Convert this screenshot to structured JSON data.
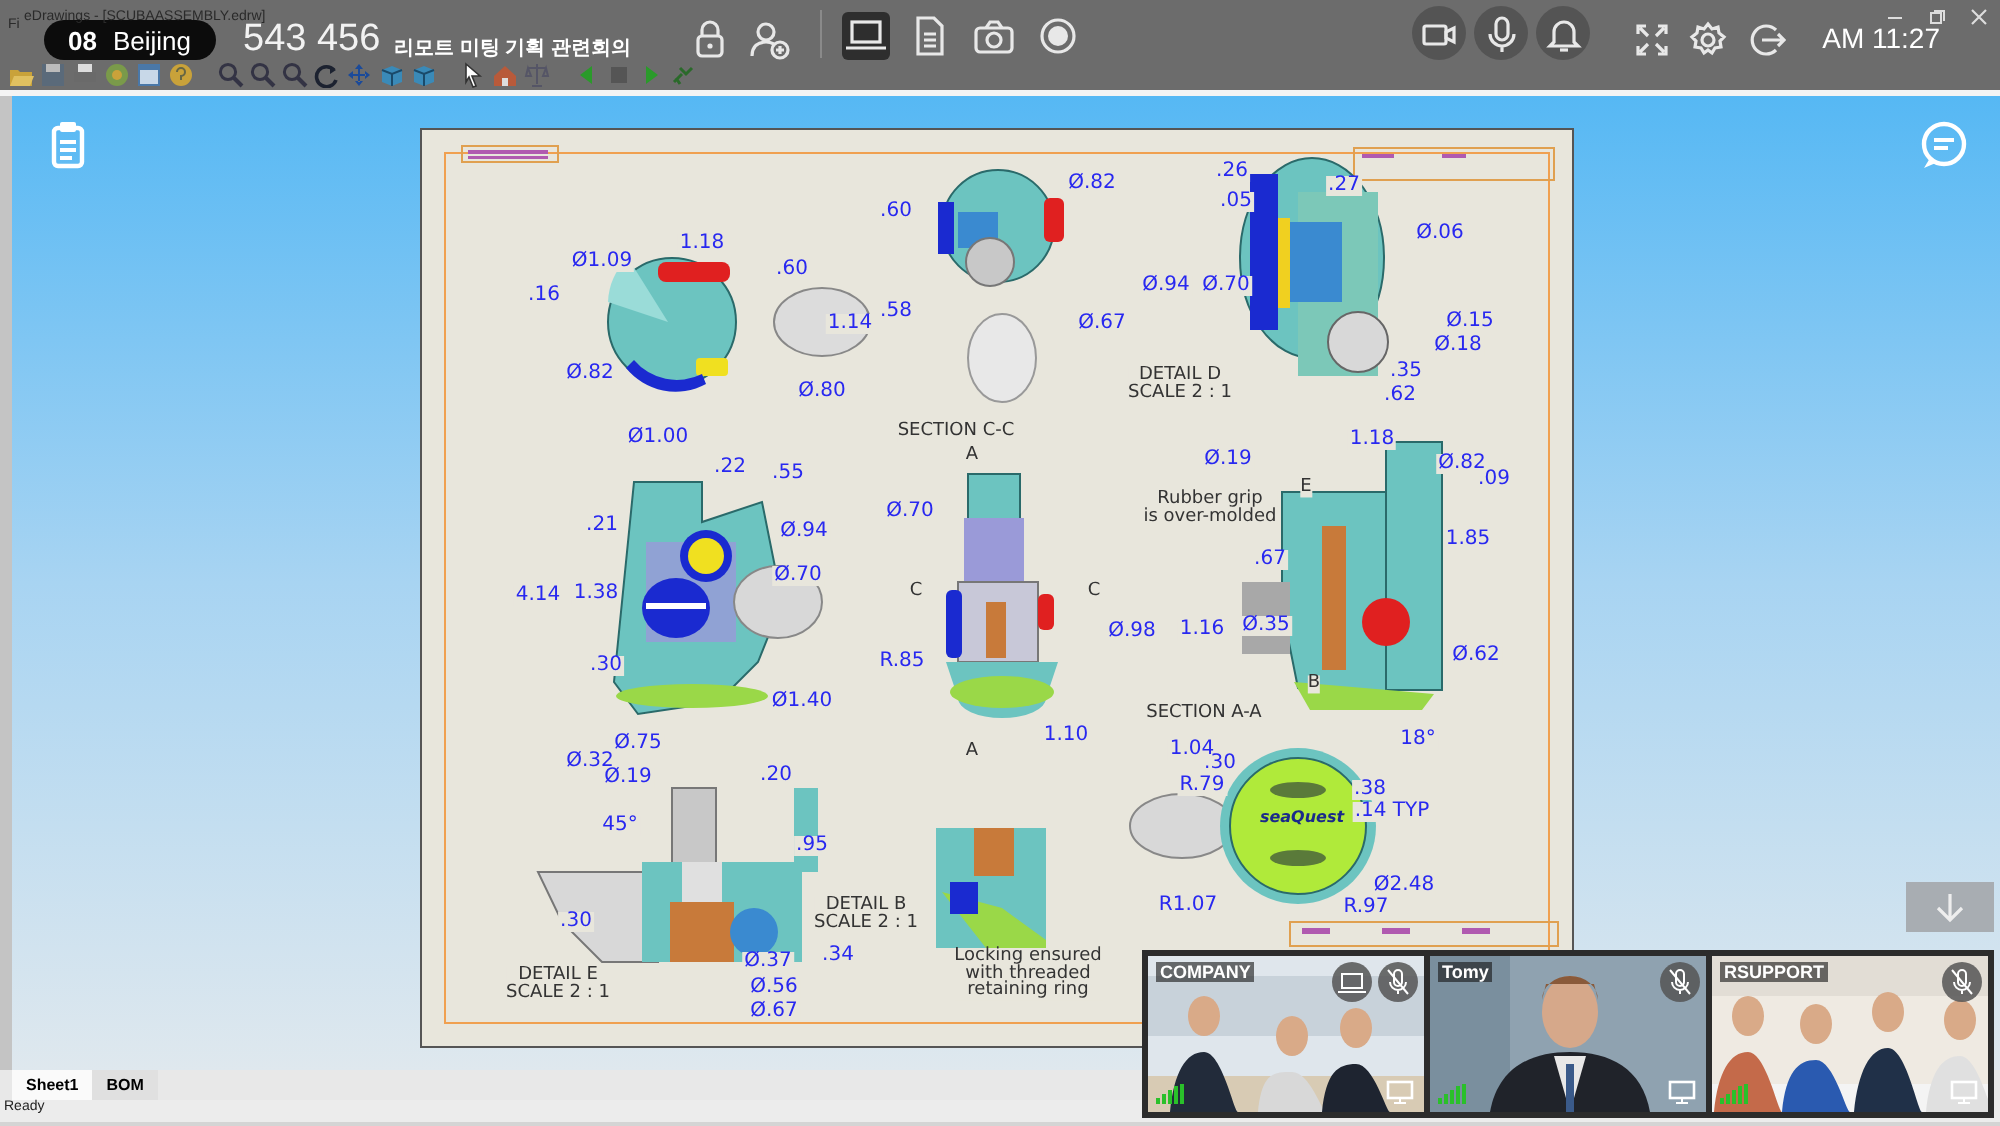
{
  "app_window": {
    "title": "eDrawings - [SCUBAASSEMBLY.edrw]",
    "menu_fragment": "Fi"
  },
  "meeting": {
    "room_number": "08",
    "room_name": "Beijing",
    "meeting_id": "543 456",
    "meeting_title": "리모트 미팅 기획 관련회의",
    "clock": "AM 11:27"
  },
  "share_modes": [
    {
      "kind": "screen",
      "selected": true
    },
    {
      "kind": "document",
      "selected": false
    },
    {
      "kind": "camera",
      "selected": false
    },
    {
      "kind": "record",
      "selected": false
    }
  ],
  "drawing": {
    "labels": [
      {
        "kind": "dimension",
        "text": "Ø1.09"
      },
      {
        "kind": "dimension",
        "text": "1.18"
      },
      {
        "kind": "dimension",
        "text": ".16"
      },
      {
        "kind": "dimension",
        "text": ".60"
      },
      {
        "kind": "dimension",
        "text": "1.14"
      },
      {
        "kind": "dimension",
        "text": "Ø.82"
      },
      {
        "kind": "dimension",
        "text": "Ø.80"
      },
      {
        "kind": "dimension",
        "text": ".60"
      },
      {
        "kind": "dimension",
        "text": "Ø.82"
      },
      {
        "kind": "dimension",
        "text": ".58"
      },
      {
        "kind": "dimension",
        "text": "Ø.67"
      },
      {
        "kind": "dimension",
        "text": ".26"
      },
      {
        "kind": "dimension",
        "text": ".27"
      },
      {
        "kind": "dimension",
        "text": ".05"
      },
      {
        "kind": "dimension",
        "text": "Ø.06"
      },
      {
        "kind": "dimension",
        "text": "Ø.94"
      },
      {
        "kind": "dimension",
        "text": "Ø.70"
      },
      {
        "kind": "dimension",
        "text": "Ø.15"
      },
      {
        "kind": "dimension",
        "text": "Ø.18"
      },
      {
        "kind": "note",
        "lines": [
          "DETAIL D",
          "SCALE 2 : 1"
        ]
      },
      {
        "kind": "dimension",
        "text": ".35"
      },
      {
        "kind": "dimension",
        "text": ".62"
      },
      {
        "kind": "note",
        "lines": [
          "SECTION C-C"
        ]
      },
      {
        "kind": "note",
        "lines": [
          "A"
        ]
      },
      {
        "kind": "dimension",
        "text": "Ø1.00"
      },
      {
        "kind": "dimension",
        "text": ".22"
      },
      {
        "kind": "dimension",
        "text": ".55"
      },
      {
        "kind": "dimension",
        "text": ".21"
      },
      {
        "kind": "dimension",
        "text": "Ø.94"
      },
      {
        "kind": "dimension",
        "text": "4.14"
      },
      {
        "kind": "dimension",
        "text": "1.38"
      },
      {
        "kind": "dimension",
        "text": "Ø.70"
      },
      {
        "kind": "dimension",
        "text": ".30"
      },
      {
        "kind": "dimension",
        "text": "R.85"
      },
      {
        "kind": "dimension",
        "text": "Ø1.40"
      },
      {
        "kind": "dimension",
        "text": "Ø.75"
      },
      {
        "kind": "dimension",
        "text": "Ø.70"
      },
      {
        "kind": "note",
        "lines": [
          "C"
        ]
      },
      {
        "kind": "note",
        "lines": [
          "C"
        ]
      },
      {
        "kind": "dimension",
        "text": "Ø.98"
      },
      {
        "kind": "dimension",
        "text": "1.10"
      },
      {
        "kind": "note",
        "lines": [
          "A"
        ]
      },
      {
        "kind": "dimension",
        "text": "Ø.19"
      },
      {
        "kind": "dimension",
        "text": "1.18"
      },
      {
        "kind": "dimension",
        "text": "Ø.82"
      },
      {
        "kind": "dimension",
        "text": ".09"
      },
      {
        "kind": "note",
        "lines": [
          "Rubber grip",
          "is over-molded"
        ]
      },
      {
        "kind": "note",
        "lines": [
          "E"
        ]
      },
      {
        "kind": "dimension",
        "text": "1.85"
      },
      {
        "kind": "dimension",
        "text": ".67"
      },
      {
        "kind": "dimension",
        "text": "1.16"
      },
      {
        "kind": "dimension",
        "text": "Ø.35"
      },
      {
        "kind": "dimension",
        "text": "Ø.62"
      },
      {
        "kind": "note",
        "lines": [
          "SECTION A-A"
        ]
      },
      {
        "kind": "dimension",
        "text": "18°"
      },
      {
        "kind": "note",
        "lines": [
          "B"
        ]
      },
      {
        "kind": "dimension",
        "text": "Ø.32"
      },
      {
        "kind": "dimension",
        "text": "Ø.19"
      },
      {
        "kind": "dimension",
        "text": ".20"
      },
      {
        "kind": "dimension",
        "text": "45°"
      },
      {
        "kind": "dimension",
        "text": ".95"
      },
      {
        "kind": "dimension",
        "text": ".30"
      },
      {
        "kind": "note",
        "lines": [
          "DETAIL B",
          "SCALE 2 : 1"
        ]
      },
      {
        "kind": "note",
        "lines": [
          "DETAIL E",
          "SCALE 2 : 1"
        ]
      },
      {
        "kind": "dimension",
        "text": "Ø.37"
      },
      {
        "kind": "dimension",
        "text": ".34"
      },
      {
        "kind": "dimension",
        "text": "Ø.56"
      },
      {
        "kind": "dimension",
        "text": "Ø.67"
      },
      {
        "kind": "dimension",
        "text": "1.04"
      },
      {
        "kind": "dimension",
        "text": ".30"
      },
      {
        "kind": "dimension",
        "text": "R.79"
      },
      {
        "kind": "dimension",
        "text": ".38"
      },
      {
        "kind": "dimension",
        "text": ".14 TYP"
      },
      {
        "kind": "dimension",
        "text": "Ø2.48"
      },
      {
        "kind": "dimension",
        "text": "R1.07"
      },
      {
        "kind": "dimension",
        "text": "R.97"
      },
      {
        "kind": "note",
        "lines": [
          "Locking ensured",
          "with threaded",
          "retaining ring"
        ]
      },
      {
        "kind": "logo",
        "text": "seaQuest"
      }
    ]
  },
  "sheet_tabs": [
    {
      "label": "Sheet1",
      "selected": true
    },
    {
      "label": "BOM",
      "selected": false
    }
  ],
  "status_bar": "Ready",
  "participants": [
    {
      "name": "COMPANY",
      "sharing_screen": true,
      "mic_muted": true
    },
    {
      "name": "Tomy",
      "sharing_screen": false,
      "mic_muted": true
    },
    {
      "name": "RSUPPORT",
      "sharing_screen": false,
      "mic_muted": true
    }
  ]
}
